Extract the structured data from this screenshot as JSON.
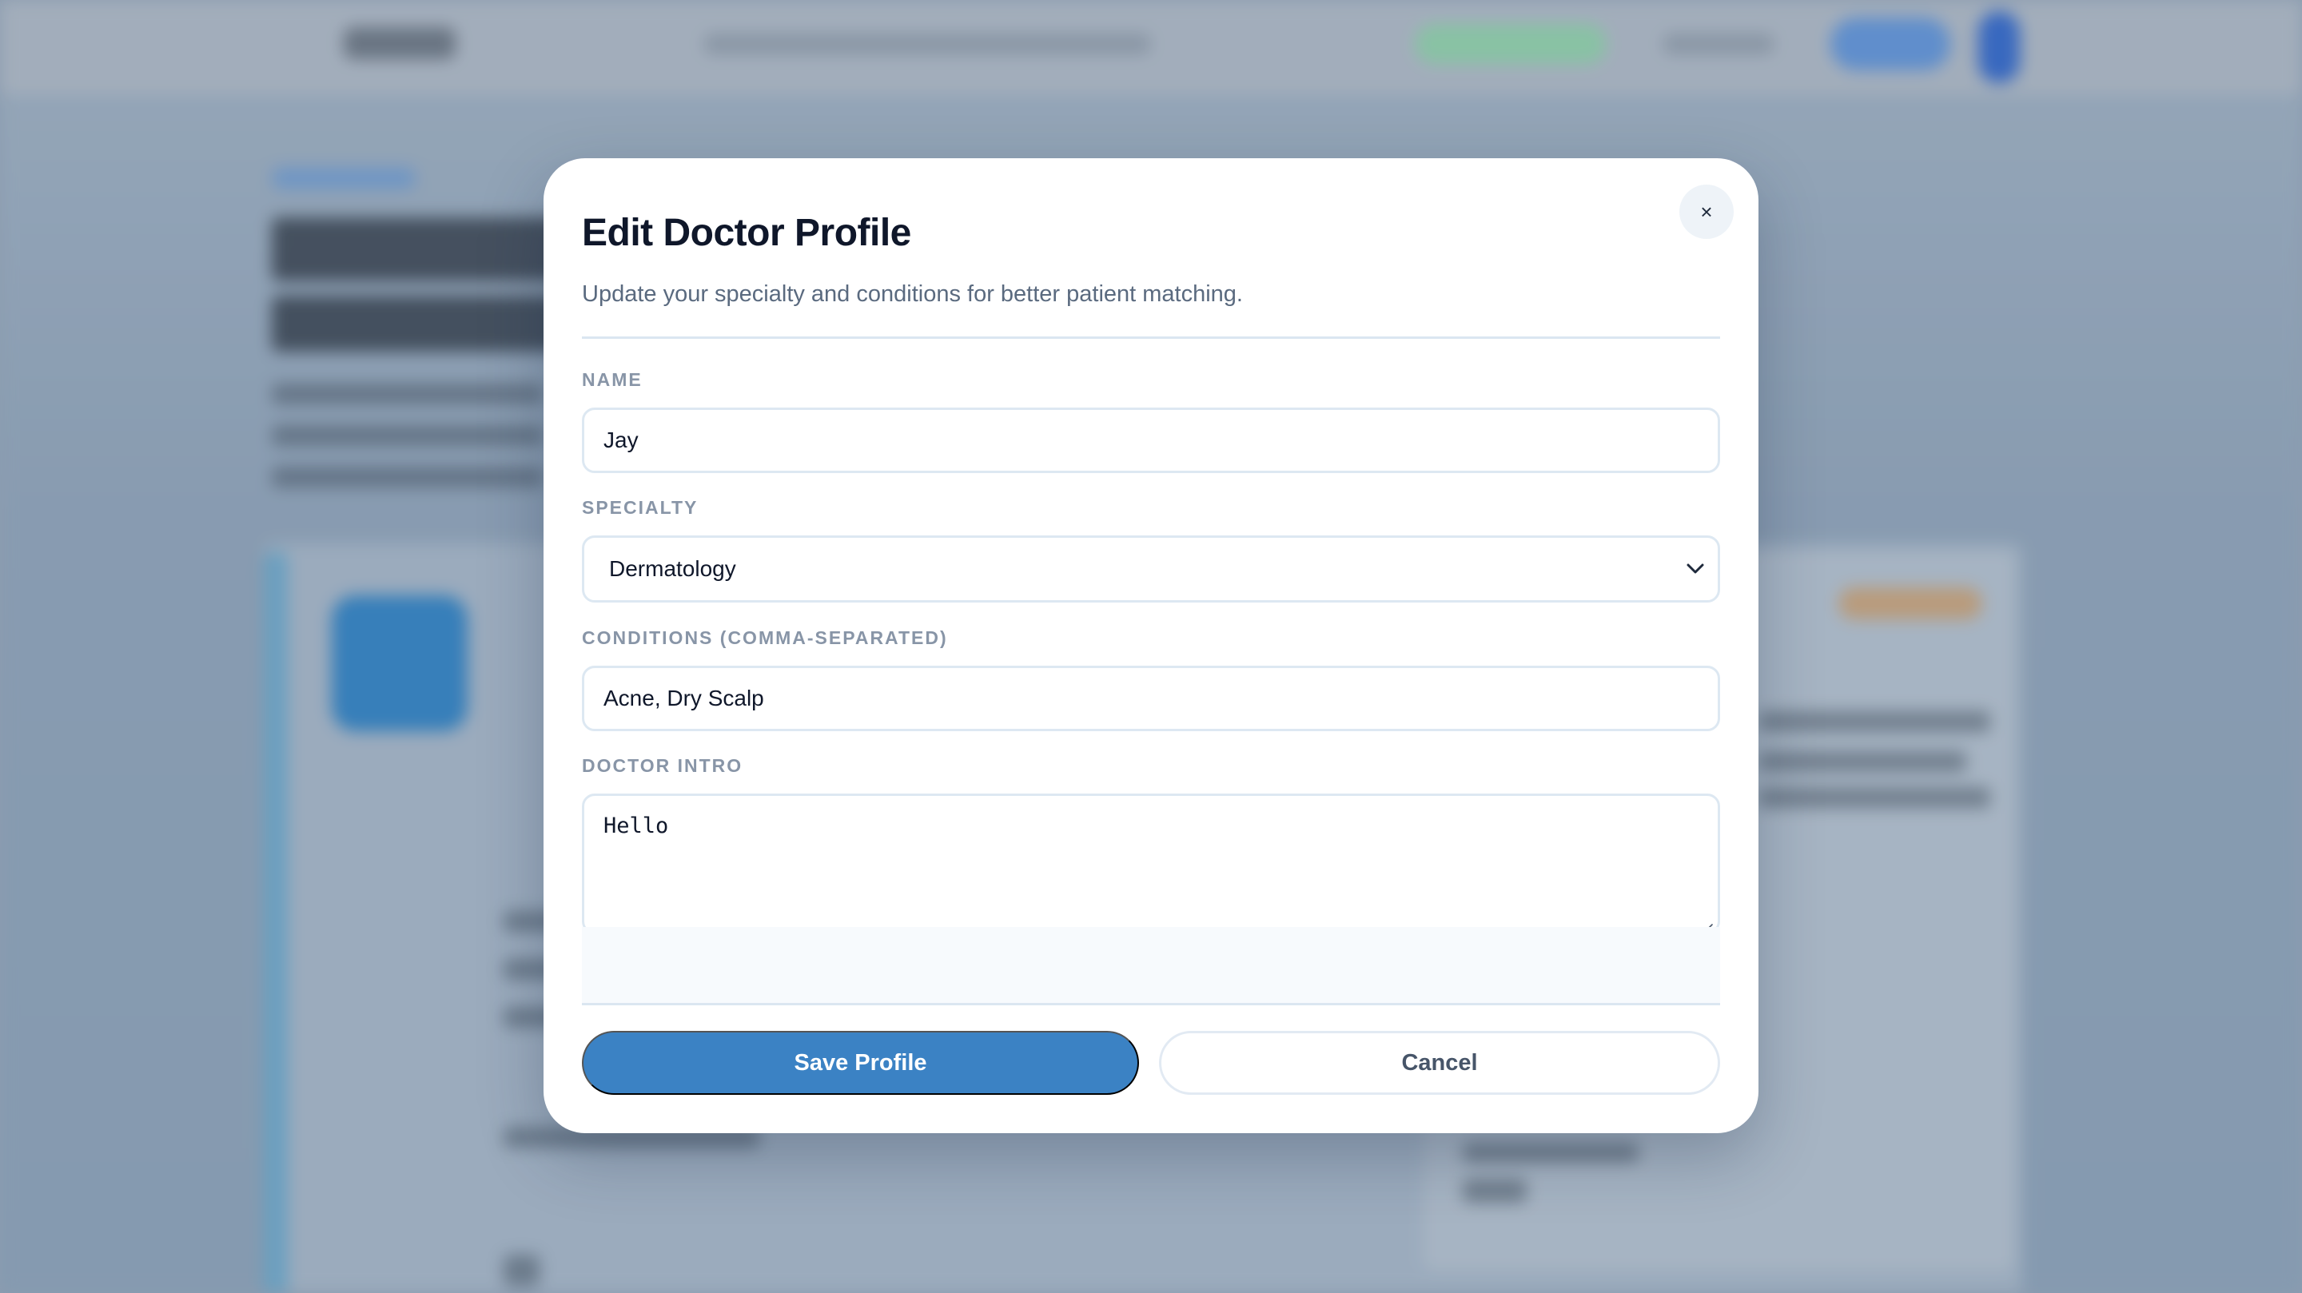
{
  "modal": {
    "title": "Edit Doctor Profile",
    "subtitle": "Update your specialty and conditions for better patient matching.",
    "close_icon": "close-icon",
    "close_glyph": "×"
  },
  "form": {
    "name": {
      "label": "NAME",
      "value": "Jay"
    },
    "specialty": {
      "label": "SPECIALTY",
      "value": "Dermatology",
      "icon": "chevron-down-icon"
    },
    "conditions": {
      "label": "CONDITIONS (COMMA-SEPARATED)",
      "value": "Acne, Dry Scalp"
    },
    "intro": {
      "label": "DOCTOR INTRO",
      "value": "Hello"
    }
  },
  "actions": {
    "save_label": "Save Profile",
    "cancel_label": "Cancel"
  },
  "colors": {
    "accent": "#3b82c4",
    "title": "#0f172a",
    "muted_label": "#8895a7"
  }
}
